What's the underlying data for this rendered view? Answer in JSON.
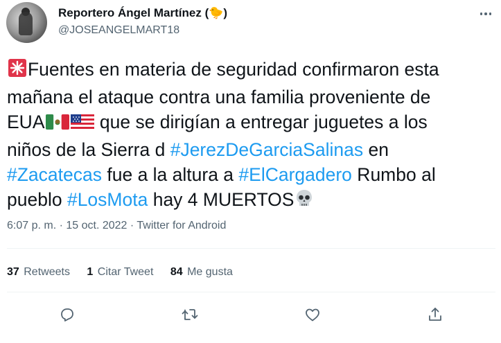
{
  "author": {
    "name": "Reportero Ángel Martínez (🐤)",
    "handle": "@JOSEANGELMART18"
  },
  "tweet": {
    "line1": "Fuentes en materia de seguridad confirmaron esta",
    "line2": "mañana el ataque contra una familia proveniente de",
    "line3_a": "EUA",
    "line3_b": " que se dirigían a entregar juguetes a los",
    "line4_a": "niños de la Sierra d ",
    "hashtag1": "#JerezDeGarciaSalinas",
    "line4_b": " en",
    "hashtag2": "#Zacatecas",
    "line5_a": " fue a la altura a ",
    "hashtag3": "#ElCargadero",
    "line5_b": " Rumbo al",
    "line6_a": "pueblo ",
    "hashtag4": "#LosMota",
    "line6_b": " hay 4 MUERTOS"
  },
  "meta": {
    "time": "6:07 p. m.",
    "separator1": " · ",
    "date": "15 oct. 2022",
    "separator2": " · ",
    "source": "Twitter for Android"
  },
  "stats": {
    "retweets_count": "37",
    "retweets_label": "Retweets",
    "quotes_count": "1",
    "quotes_label": "Citar Tweet",
    "likes_count": "84",
    "likes_label": "Me gusta"
  },
  "icons": {
    "siren": "siren-icon",
    "mexico_flag": "mexico-flag-icon",
    "usa_flag": "usa-flag-icon",
    "skull": "skull-icon",
    "reply": "reply-icon",
    "retweet": "retweet-icon",
    "like": "like-icon",
    "share": "share-icon"
  },
  "colors": {
    "hashtag": "#1d9bf0",
    "secondary_text": "#536471",
    "primary_text": "#0f1419"
  }
}
